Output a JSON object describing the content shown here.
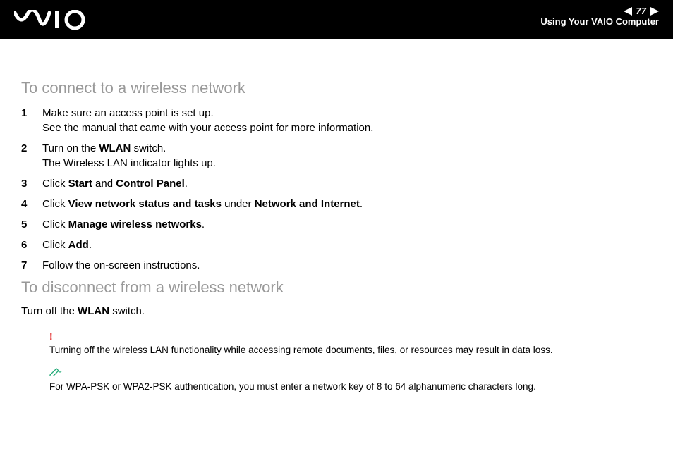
{
  "header": {
    "page_number": "77",
    "section": "Using Your VAIO Computer"
  },
  "section1": {
    "heading": "To connect to a wireless network",
    "steps": [
      {
        "num": "1",
        "text_a": "Make sure an access point is set up.",
        "text_b": "See the manual that came with your access point for more information."
      },
      {
        "num": "2",
        "text_a": "Turn on the ",
        "bold_a": "WLAN",
        "text_b": " switch.",
        "text_c": "The Wireless LAN indicator lights up."
      },
      {
        "num": "3",
        "text_a": "Click ",
        "bold_a": "Start",
        "text_b": " and ",
        "bold_b": "Control Panel",
        "text_c": "."
      },
      {
        "num": "4",
        "text_a": "Click ",
        "bold_a": "View network status and tasks",
        "text_b": " under ",
        "bold_b": "Network and Internet",
        "text_c": "."
      },
      {
        "num": "5",
        "text_a": "Click ",
        "bold_a": "Manage wireless networks",
        "text_b": "."
      },
      {
        "num": "6",
        "text_a": "Click ",
        "bold_a": "Add",
        "text_b": "."
      },
      {
        "num": "7",
        "text_a": "Follow the on-screen instructions."
      }
    ]
  },
  "section2": {
    "heading": "To disconnect from a wireless network",
    "body_a": "Turn off the ",
    "body_bold": "WLAN",
    "body_b": " switch."
  },
  "warn_note": {
    "icon": "!",
    "text": "Turning off the wireless LAN functionality while accessing remote documents, files, or resources may result in data loss."
  },
  "tip_note": {
    "text": "For WPA-PSK or WPA2-PSK authentication, you must enter a network key of 8 to 64 alphanumeric characters long."
  }
}
